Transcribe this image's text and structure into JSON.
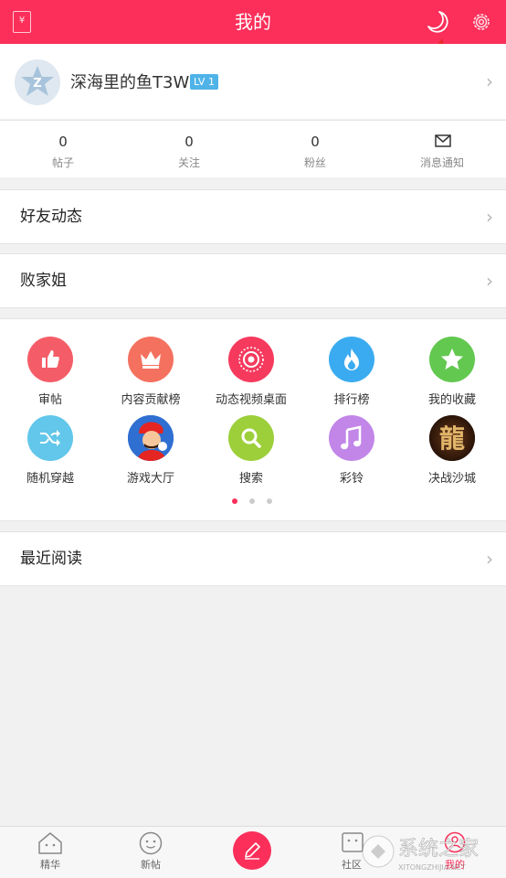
{
  "header": {
    "title": "我的",
    "left_icon_glyph": "¥"
  },
  "profile": {
    "username": "深海里的鱼T3W",
    "level": "LV 1"
  },
  "stats": [
    {
      "value": "0",
      "label": "帖子"
    },
    {
      "value": "0",
      "label": "关注"
    },
    {
      "value": "0",
      "label": "粉丝"
    },
    {
      "value": "",
      "label": "消息通知",
      "icon": "mail-icon"
    }
  ],
  "rows": {
    "friends": "好友动态",
    "baijiajie": "败家姐",
    "recent": "最近阅读"
  },
  "grid": [
    {
      "label": "审帖",
      "icon": "thumbs-up-icon",
      "color": "#f45d68"
    },
    {
      "label": "内容贡献榜",
      "icon": "crown-icon",
      "color": "#f4715f"
    },
    {
      "label": "动态视频桌面",
      "icon": "target-icon",
      "color": "#f53a5e"
    },
    {
      "label": "排行榜",
      "icon": "flame-icon",
      "color": "#3aabf0"
    },
    {
      "label": "我的收藏",
      "icon": "star-icon",
      "color": "#63c850"
    },
    {
      "label": "随机穿越",
      "icon": "shuffle-icon",
      "color": "#62c7ea"
    },
    {
      "label": "游戏大厅",
      "icon": "mario-avatar-icon",
      "color": "#2f6fd1"
    },
    {
      "label": "搜索",
      "icon": "search-icon",
      "color": "#9ccf3a"
    },
    {
      "label": "彩铃",
      "icon": "music-note-icon",
      "color": "#c186e8"
    },
    {
      "label": "决战沙城",
      "icon": "dragon-avatar-icon",
      "color": "#3a1b0f",
      "glyph": "龍"
    }
  ],
  "pagination": {
    "pages": 3,
    "active": 0
  },
  "nav": [
    {
      "label": "精华",
      "icon": "home-face-icon"
    },
    {
      "label": "新帖",
      "icon": "smile-icon"
    },
    {
      "label": "",
      "icon": "pencil-icon"
    },
    {
      "label": "社区",
      "icon": "community-icon"
    },
    {
      "label": "我的",
      "icon": "profile-icon"
    }
  ],
  "watermark": {
    "text": "系统之家",
    "sub": "XITONGZHIJIA.NET"
  },
  "colors": {
    "primary": "#fb2f5a",
    "level_badge": "#4fb3e8"
  }
}
